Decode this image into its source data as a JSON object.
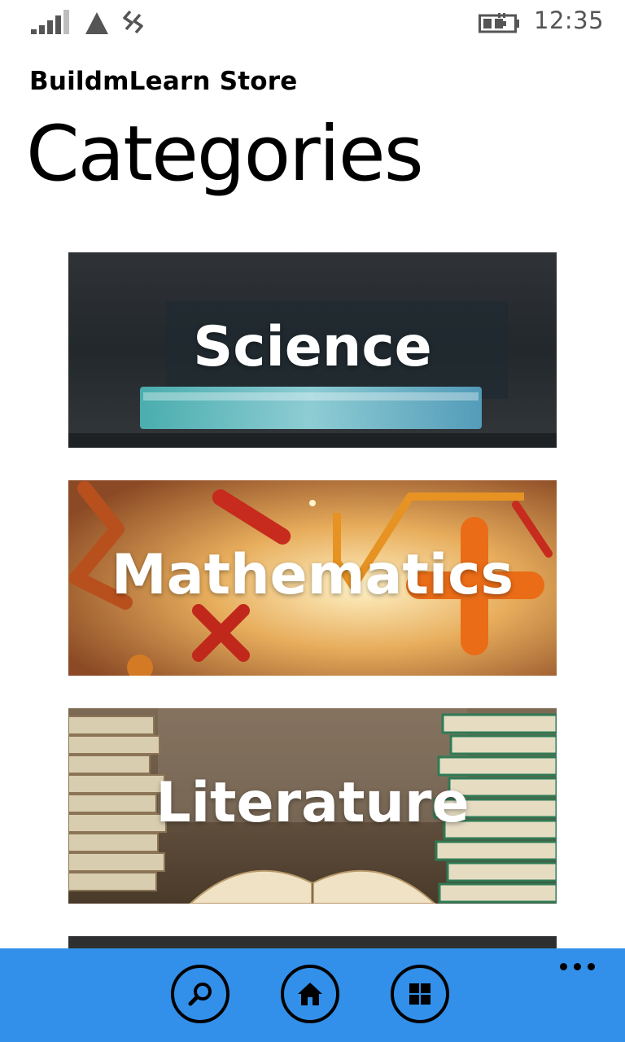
{
  "status_bar": {
    "time": "12:35",
    "icons": [
      "signal-icon",
      "network-triangle-icon",
      "wifi-icon",
      "battery-charging-icon"
    ]
  },
  "header": {
    "app_title": "BuildmLearn Store",
    "page_title": "Categories"
  },
  "categories": [
    {
      "label": "Science"
    },
    {
      "label": "Mathematics"
    },
    {
      "label": "Literature"
    }
  ],
  "app_bar": {
    "background": "#3290ea",
    "buttons": [
      "search-icon",
      "home-icon",
      "apps-grid-icon"
    ],
    "more_icon": "more-dots-icon"
  }
}
